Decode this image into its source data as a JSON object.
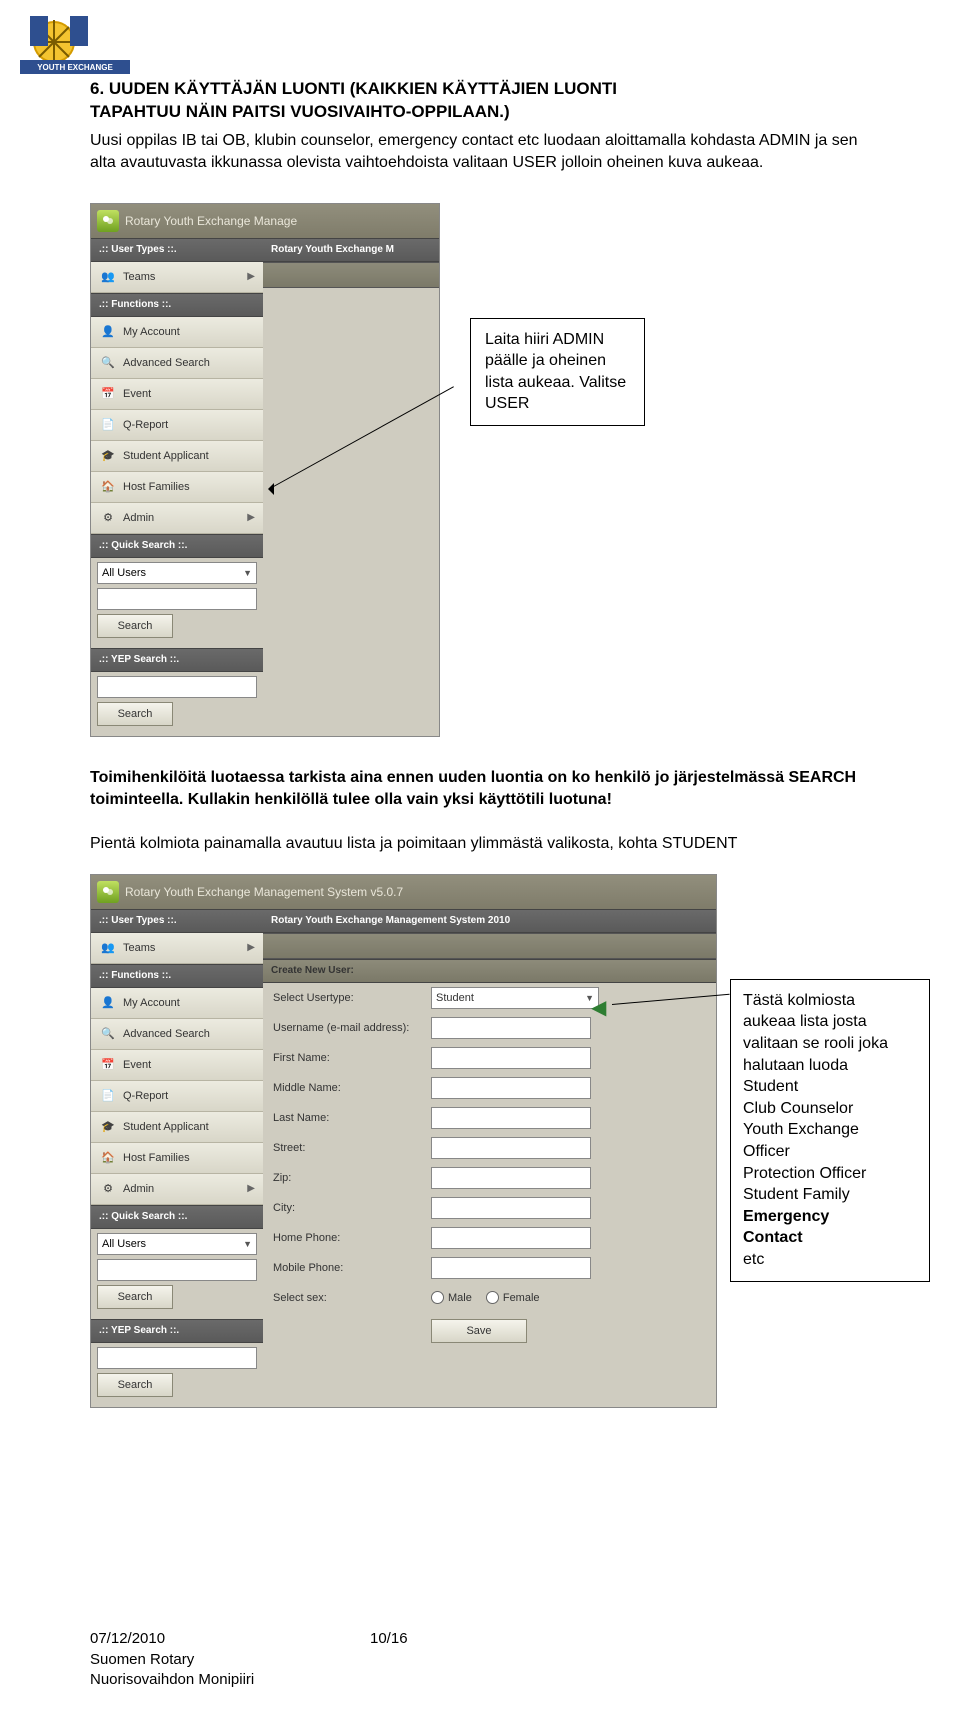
{
  "logo": {
    "banner_text": "YOUTH EXCHANGE"
  },
  "section": {
    "heading_line1": "6. UUDEN KÄYTTÄJÄN LUONTI (KAIKKIEN KÄYTTÄJIEN LUONTI",
    "heading_line2": "TAPAHTUU NÄIN PAITSI VUOSIVAIHTO-OPPILAAN.)",
    "intro": "Uusi oppilas IB tai OB, klubin counselor, emergency contact etc luodaan aloittamalla kohdasta ADMIN ja sen alta avautuvasta ikkunassa olevista vaihtoehdoista valitaan USER jolloin oheinen kuva aukeaa."
  },
  "shot1": {
    "title": "Rotary Youth Exchange Manage",
    "main_header": "Rotary Youth Exchange M",
    "usertypes_hdr": ".:: User Types ::.",
    "functions_hdr": ".:: Functions ::.",
    "quick_hdr": ".:: Quick Search ::.",
    "yep_hdr": ".:: YEP Search ::.",
    "teams": "Teams",
    "fn": [
      "My Account",
      "Advanced Search",
      "Event",
      "Q-Report",
      "Student Applicant",
      "Host Families",
      "Admin"
    ],
    "all_users": "All Users",
    "search": "Search"
  },
  "callout1": {
    "l1": "Laita hiiri ADMIN",
    "l2": "päälle ja oheinen",
    "l3": "lista aukeaa. Valitse",
    "l4": "USER"
  },
  "mid_para": {
    "p1_a": "Toimihenkilöitä luotaessa tarkista aina ennen uuden luontia on ko henkilö jo järjestelmässä SEARCH toiminteella. ",
    "p1_b": "Kullakin henkilöllä tulee olla vain yksi käyttötili luotuna!",
    "p2": "Pientä kolmiota painamalla avautuu lista ja poimitaan ylimmästä valikosta, kohta STUDENT"
  },
  "shot2": {
    "title": "Rotary Youth Exchange Management System v5.0.7",
    "main_header": "Rotary Youth Exchange Management System 2010",
    "panel": "Create New User:",
    "labels": {
      "usertype": "Select Usertype:",
      "username": "Username (e-mail address):",
      "first": "First Name:",
      "middle": "Middle Name:",
      "last": "Last Name:",
      "street": "Street:",
      "zip": "Zip:",
      "city": "City:",
      "homeph": "Home Phone:",
      "mobile": "Mobile Phone:",
      "sex": "Select sex:"
    },
    "usertype_value": "Student",
    "sex_male": "Male",
    "sex_female": "Female",
    "save": "Save"
  },
  "callout2": {
    "l1": "Tästä kolmiosta",
    "l2": "aukeaa lista josta",
    "l3": "valitaan se rooli joka",
    "l4": "halutaan luoda",
    "l5": "Student",
    "l6": "Club Counselor",
    "l7": "Youth Exchange",
    "l8": "Officer",
    "l9": "Protection Officer",
    "l10": "Student Family",
    "l11a": "Emergency",
    "l11b": "Contact",
    "l12": "etc"
  },
  "footer": {
    "date": "07/12/2010",
    "page": "10/16",
    "org1": "Suomen Rotary",
    "org2": "Nuorisovaihdon Monipiiri"
  }
}
